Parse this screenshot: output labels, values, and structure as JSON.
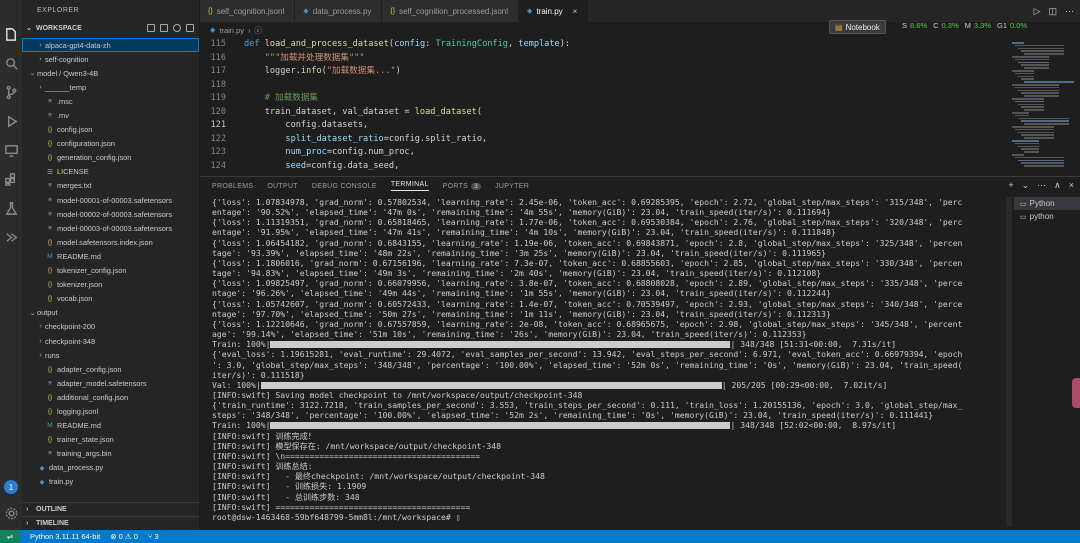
{
  "sidebar": {
    "header": "EXPLORER",
    "workspace": "WORKSPACE",
    "tree": [
      {
        "label": "alpaca-gpt4-data-zh",
        "kind": "folder",
        "indent": 1,
        "selected": true
      },
      {
        "label": "self-cognition",
        "kind": "folder",
        "indent": 1
      },
      {
        "label": "model / Qwen3-4B",
        "kind": "folder-open",
        "indent": 0
      },
      {
        "label": "______temp",
        "kind": "folder",
        "indent": 1
      },
      {
        "label": ".msc",
        "kind": "file",
        "icon": "txt",
        "indent": 1
      },
      {
        "label": ".mv",
        "kind": "file",
        "icon": "txt",
        "indent": 1
      },
      {
        "label": "config.json",
        "kind": "file",
        "icon": "json",
        "indent": 1
      },
      {
        "label": "configuration.json",
        "kind": "file",
        "icon": "json",
        "indent": 1
      },
      {
        "label": "generation_config.json",
        "kind": "file",
        "icon": "json",
        "indent": 1
      },
      {
        "label": "LICENSE",
        "kind": "file",
        "icon": "lic",
        "indent": 1
      },
      {
        "label": "merges.txt",
        "kind": "file",
        "icon": "txt",
        "indent": 1
      },
      {
        "label": "model-00001-of-00003.safetensors",
        "kind": "file",
        "icon": "safe",
        "indent": 1
      },
      {
        "label": "model-00002-of-00003.safetensors",
        "kind": "file",
        "icon": "safe",
        "indent": 1
      },
      {
        "label": "model-00003-of-00003.safetensors",
        "kind": "file",
        "icon": "safe",
        "indent": 1
      },
      {
        "label": "model.safetensors.index.json",
        "kind": "file",
        "icon": "json",
        "indent": 1
      },
      {
        "label": "README.md",
        "kind": "file",
        "icon": "md",
        "indent": 1
      },
      {
        "label": "tokenizer_config.json",
        "kind": "file",
        "icon": "json",
        "indent": 1
      },
      {
        "label": "tokenizer.json",
        "kind": "file",
        "icon": "json",
        "indent": 1
      },
      {
        "label": "vocab.json",
        "kind": "file",
        "icon": "json",
        "indent": 1
      },
      {
        "label": "output",
        "kind": "folder-open",
        "indent": 0
      },
      {
        "label": "checkpoint-200",
        "kind": "folder",
        "indent": 1
      },
      {
        "label": "checkpoint-348",
        "kind": "folder",
        "indent": 1
      },
      {
        "label": "runs",
        "kind": "folder",
        "indent": 1
      },
      {
        "label": "adapter_config.json",
        "kind": "file",
        "icon": "json",
        "indent": 1
      },
      {
        "label": "adapter_model.safetensors",
        "kind": "file",
        "icon": "safe",
        "indent": 1
      },
      {
        "label": "additional_config.json",
        "kind": "file",
        "icon": "json",
        "indent": 1
      },
      {
        "label": "logging.jsonl",
        "kind": "file",
        "icon": "json",
        "indent": 1
      },
      {
        "label": "README.md",
        "kind": "file",
        "icon": "md",
        "indent": 1
      },
      {
        "label": "trainer_state.json",
        "kind": "file",
        "icon": "json",
        "indent": 1
      },
      {
        "label": "training_args.bin",
        "kind": "file",
        "icon": "bin",
        "indent": 1
      },
      {
        "label": "data_process.py",
        "kind": "file",
        "icon": "py",
        "indent": 0
      },
      {
        "label": "train.py",
        "kind": "file",
        "icon": "py",
        "indent": 0
      }
    ],
    "outline": "OUTLINE",
    "timeline": "TIMELINE"
  },
  "tabs": [
    {
      "label": "self_cognition.jsonl",
      "icon": "json",
      "active": false
    },
    {
      "label": "data_process.py",
      "icon": "py",
      "active": false
    },
    {
      "label": "self_cognition_processed.jsonl",
      "icon": "json",
      "active": false
    },
    {
      "label": "train.py",
      "icon": "py",
      "active": true
    }
  ],
  "breadcrumb": "train.py",
  "topbar": {
    "notebook": "Notebook",
    "resources": [
      {
        "label": "S",
        "value": "8.6%"
      },
      {
        "label": "C",
        "value": "0.3%"
      },
      {
        "label": "M",
        "value": "3.3%"
      },
      {
        "label": "G1",
        "value": "0.0%"
      }
    ]
  },
  "editor": {
    "current_line": 121,
    "lines": [
      {
        "n": 115,
        "code": "def load_and_process_dataset(config: TrainingConfig, template):"
      },
      {
        "n": 116,
        "code": "    \"\"\"加载并处理数据集\"\"\""
      },
      {
        "n": 117,
        "code": "    logger.info(\"加载数据集...\")"
      },
      {
        "n": 118,
        "code": ""
      },
      {
        "n": 119,
        "code": "    # 加载数据集"
      },
      {
        "n": 120,
        "code": "    train_dataset, val_dataset = load_dataset("
      },
      {
        "n": 121,
        "code": "        config.datasets,"
      },
      {
        "n": 122,
        "code": "        split_dataset_ratio=config.split_ratio,"
      },
      {
        "n": 123,
        "code": "        num_proc=config.num_proc,"
      },
      {
        "n": 124,
        "code": "        seed=config.data_seed,"
      }
    ]
  },
  "panel": {
    "tabs": [
      "PROBLEMS",
      "OUTPUT",
      "DEBUG CONSOLE",
      "TERMINAL",
      "PORTS",
      "JUPYTER"
    ],
    "active_tab": "TERMINAL",
    "ports_count": "3",
    "terminals": [
      "Python",
      "python"
    ],
    "lines": [
      {
        "t": "{'loss': 1.07834978, 'grad_norm': 0.57802534, 'learning_rate': 2.45e-06, 'token_acc': 0.69285395, 'epoch': 2.72, 'global_step/max_steps': '315/348', 'perc"
      },
      {
        "t": "entage': '90.52%', 'elapsed_time': '47m 0s', 'remaining_time': '4m 55s', 'memory(GiB)': 23.04, 'train_speed(iter/s)': 0.111694}"
      },
      {
        "t": "{'loss': 1.11319351, 'grad_norm': 0.65818465, 'learning_rate': 1.77e-06, 'token_acc': 0.69530384, 'epoch': 2.76, 'global_step/max_steps': '320/348', 'perc"
      },
      {
        "t": "entage': '91.95%', 'elapsed_time': '47m 41s', 'remaining_time': '4m 10s', 'memory(GiB)': 23.04, 'train_speed(iter/s)': 0.111848}"
      },
      {
        "t": "{'loss': 1.06454182, 'grad_norm': 0.6843155, 'learning_rate': 1.19e-06, 'token_acc': 0.69843871, 'epoch': 2.8, 'global_step/max_steps': '325/348', 'percen"
      },
      {
        "t": "tage': '93.39%', 'elapsed_time': '48m 22s', 'remaining_time': '3m 25s', 'memory(GiB)': 23.04, 'train_speed(iter/s)': 0.111965}"
      },
      {
        "t": "{'loss': 1.1806016, 'grad_norm': 0.67156196, 'learning_rate': 7.3e-07, 'token_acc': 0.68855603, 'epoch': 2.85, 'global_step/max_steps': '330/348', 'percen"
      },
      {
        "t": "tage': '94.83%', 'elapsed_time': '49m 3s', 'remaining_time': '2m 40s', 'memory(GiB)': 23.04, 'train_speed(iter/s)': 0.112108}"
      },
      {
        "t": "{'loss': 1.09825497, 'grad_norm': 0.66079956, 'learning_rate': 3.8e-07, 'token_acc': 0.68808028, 'epoch': 2.89, 'global_step/max_steps': '335/348', 'perce"
      },
      {
        "t": "ntage': '96.26%', 'elapsed_time': '49m 44s', 'remaining_time': '1m 55s', 'memory(GiB)': 23.04, 'train_speed(iter/s)': 0.112244}"
      },
      {
        "t": "{'loss': 1.05742607, 'grad_norm': 0.60572433, 'learning_rate': 1.4e-07, 'token_acc': 0.70539497, 'epoch': 2.93, 'global_step/max_steps': '340/348', 'perce"
      },
      {
        "t": "ntage': '97.70%', 'elapsed_time': '50m 27s', 'remaining_time': '1m 11s', 'memory(GiB)': 23.04, 'train_speed(iter/s)': 0.112313}"
      },
      {
        "t": "{'loss': 1.12210646, 'grad_norm': 0.67557859, 'learning_rate': 2e-08, 'token_acc': 0.68965675, 'epoch': 2.98, 'global_step/max_steps': '345/348', 'percent"
      },
      {
        "t": "age': '99.14%', 'elapsed_time': '51m 10s', 'remaining_time': '26s', 'memory(GiB)': 23.04, 'train_speed(iter/s)': 0.112353}"
      },
      {
        "t": "Train: 100%|",
        "bar": 1.0,
        "tail": "| 348/348 [51:31<00:00,  7.31s/it]"
      },
      {
        "t": "{'eval_loss': 1.19615281, 'eval_runtime': 29.4072, 'eval_samples_per_second': 13.942, 'eval_steps_per_second': 6.971, 'eval_token_acc': 0.66979394, 'epoch"
      },
      {
        "t": "': 3.0, 'global_step/max_steps': '348/348', 'percentage': '100.00%', 'elapsed_time': '52m 0s', 'remaining_time': '0s', 'memory(GiB)': 23.04, 'train_speed("
      },
      {
        "t": "iter/s)': 0.111518}"
      },
      {
        "t": "Val: 100%|",
        "bar": 1.0,
        "tail": "| 205/205 [00:29<00:00,  7.02it/s]"
      },
      {
        "t": "[INFO:swift] Saving model checkpoint to /mnt/workspace/output/checkpoint-348"
      },
      {
        "t": "{'train_runtime': 3122.7218, 'train_samples_per_second': 3.553, 'train_steps_per_second': 0.111, 'train_loss': 1.20155136, 'epoch': 3.0, 'global_step/max_"
      },
      {
        "t": "steps': '348/348', 'percentage': '100.00%', 'elapsed_time': '52m 2s', 'remaining_time': '0s', 'memory(GiB)': 23.04, 'train_speed(iter/s)': 0.111441}"
      },
      {
        "t": "Train: 100%|",
        "bar": 1.0,
        "tail": "| 348/348 [52:02<00:00,  8.97s/it]"
      },
      {
        "t": "[INFO:swift] 训练完成！"
      },
      {
        "t": "[INFO:swift] 模型保存在: /mnt/workspace/output/checkpoint-348"
      },
      {
        "t": "[INFO:swift] \\n========================================"
      },
      {
        "t": "[INFO:swift] 训练总结:"
      },
      {
        "t": "[INFO:swift]   - 最终checkpoint: /mnt/workspace/output/checkpoint-348"
      },
      {
        "t": "[INFO:swift]   - 训练损失: 1.1909"
      },
      {
        "t": "[INFO:swift]   - 总训练步数: 348"
      },
      {
        "t": "[INFO:swift] ========================================"
      },
      {
        "t": "root@dsw-1463468-59bf648799-5mm8l:/mnt/workspace# ▯"
      }
    ]
  },
  "statusbar": {
    "python": "Python 3.11.11 64-bit",
    "errors": "0",
    "warnings": "0",
    "ports": "3",
    "account_badge": "1"
  },
  "colors": {
    "accent": "#007acc",
    "selection": "#04395e",
    "bg": "#1e1e1e"
  }
}
